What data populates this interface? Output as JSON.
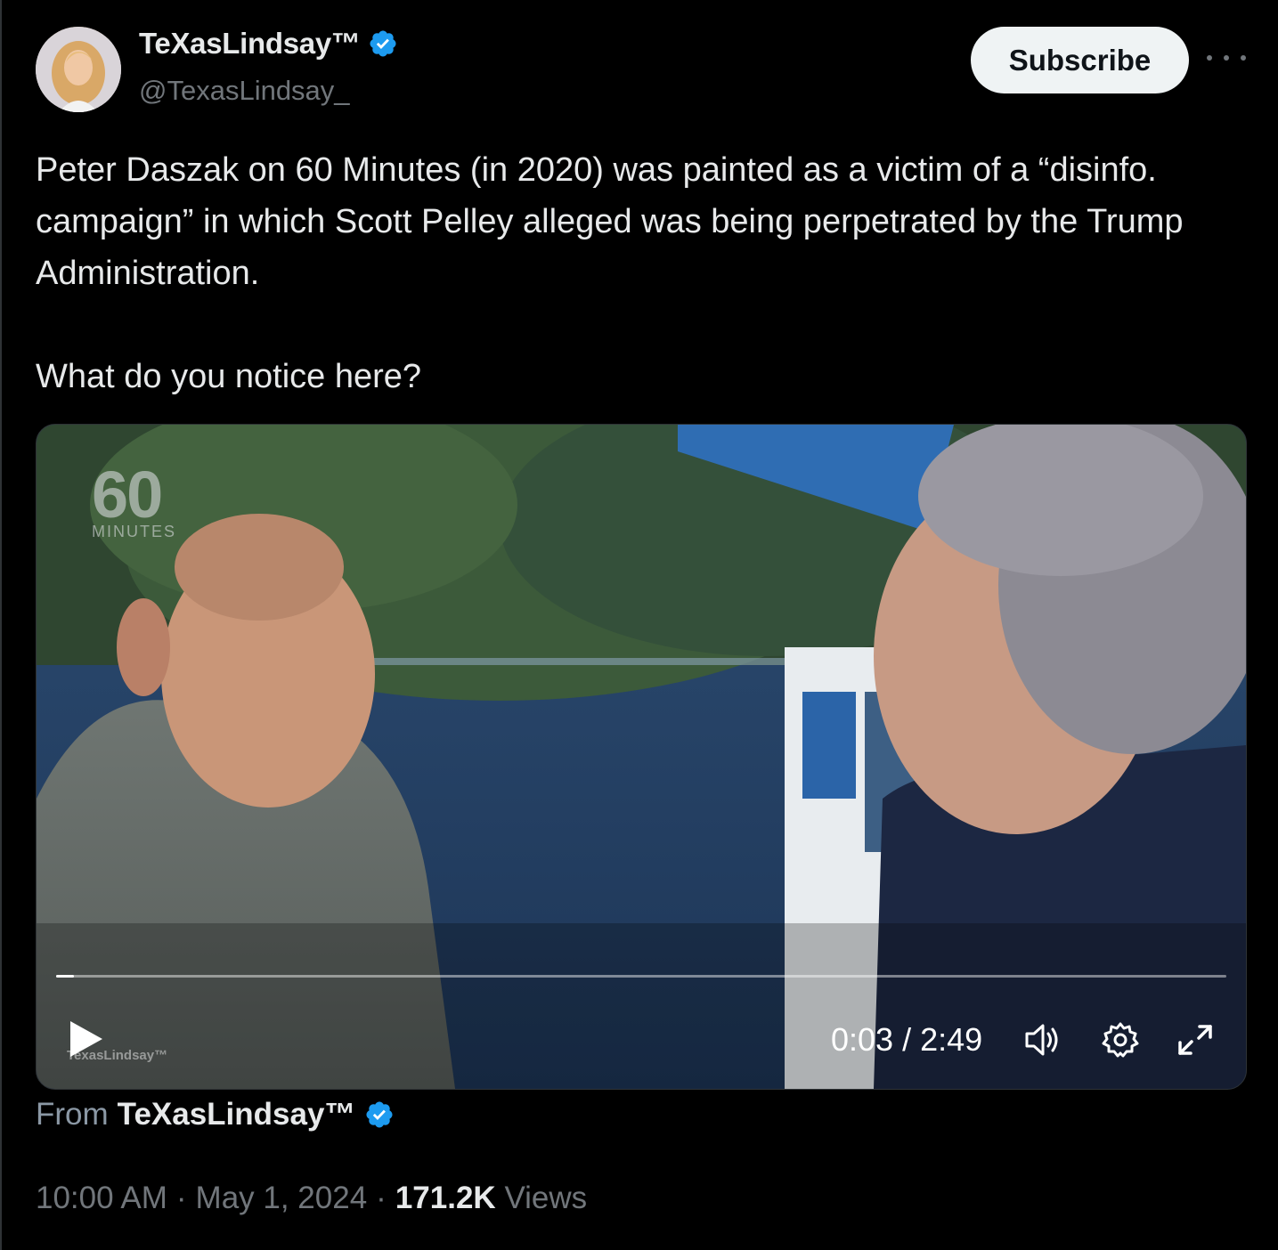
{
  "author": {
    "display_name": "TeXasLindsay™",
    "handle": "@TexasLindsay_",
    "verified_color": "#1d9bf0"
  },
  "header": {
    "subscribe_label": "Subscribe",
    "more_icon": "more-horizontal-icon"
  },
  "tweet": {
    "paragraphs": [
      "Peter Daszak on 60 Minutes (in 2020) was painted as a victim of a “disinfo. campaign” in which Scott Pelley alleged was being perpetrated by the Trump Administration.",
      "What do you notice here?"
    ]
  },
  "video": {
    "logo_number": "60",
    "logo_word": "MINUTES",
    "watermark": "TexasLindsay™",
    "time_display": "0:03 / 2:49",
    "progress_fraction": 0.015,
    "icons": [
      "play-icon",
      "volume-icon",
      "settings-gear-icon",
      "fullscreen-icon"
    ]
  },
  "attribution": {
    "from_label": "From",
    "from_name": "TeXasLindsay™"
  },
  "meta": {
    "time": "10:00 AM",
    "separator": "·",
    "date": "May 1, 2024",
    "views_count": "171.2K",
    "views_label": "Views"
  },
  "colors": {
    "background": "#000000",
    "text_primary": "#e7e9ea",
    "text_secondary": "#71767b",
    "verified": "#1d9bf0",
    "subscribe_bg": "#eff3f4"
  }
}
